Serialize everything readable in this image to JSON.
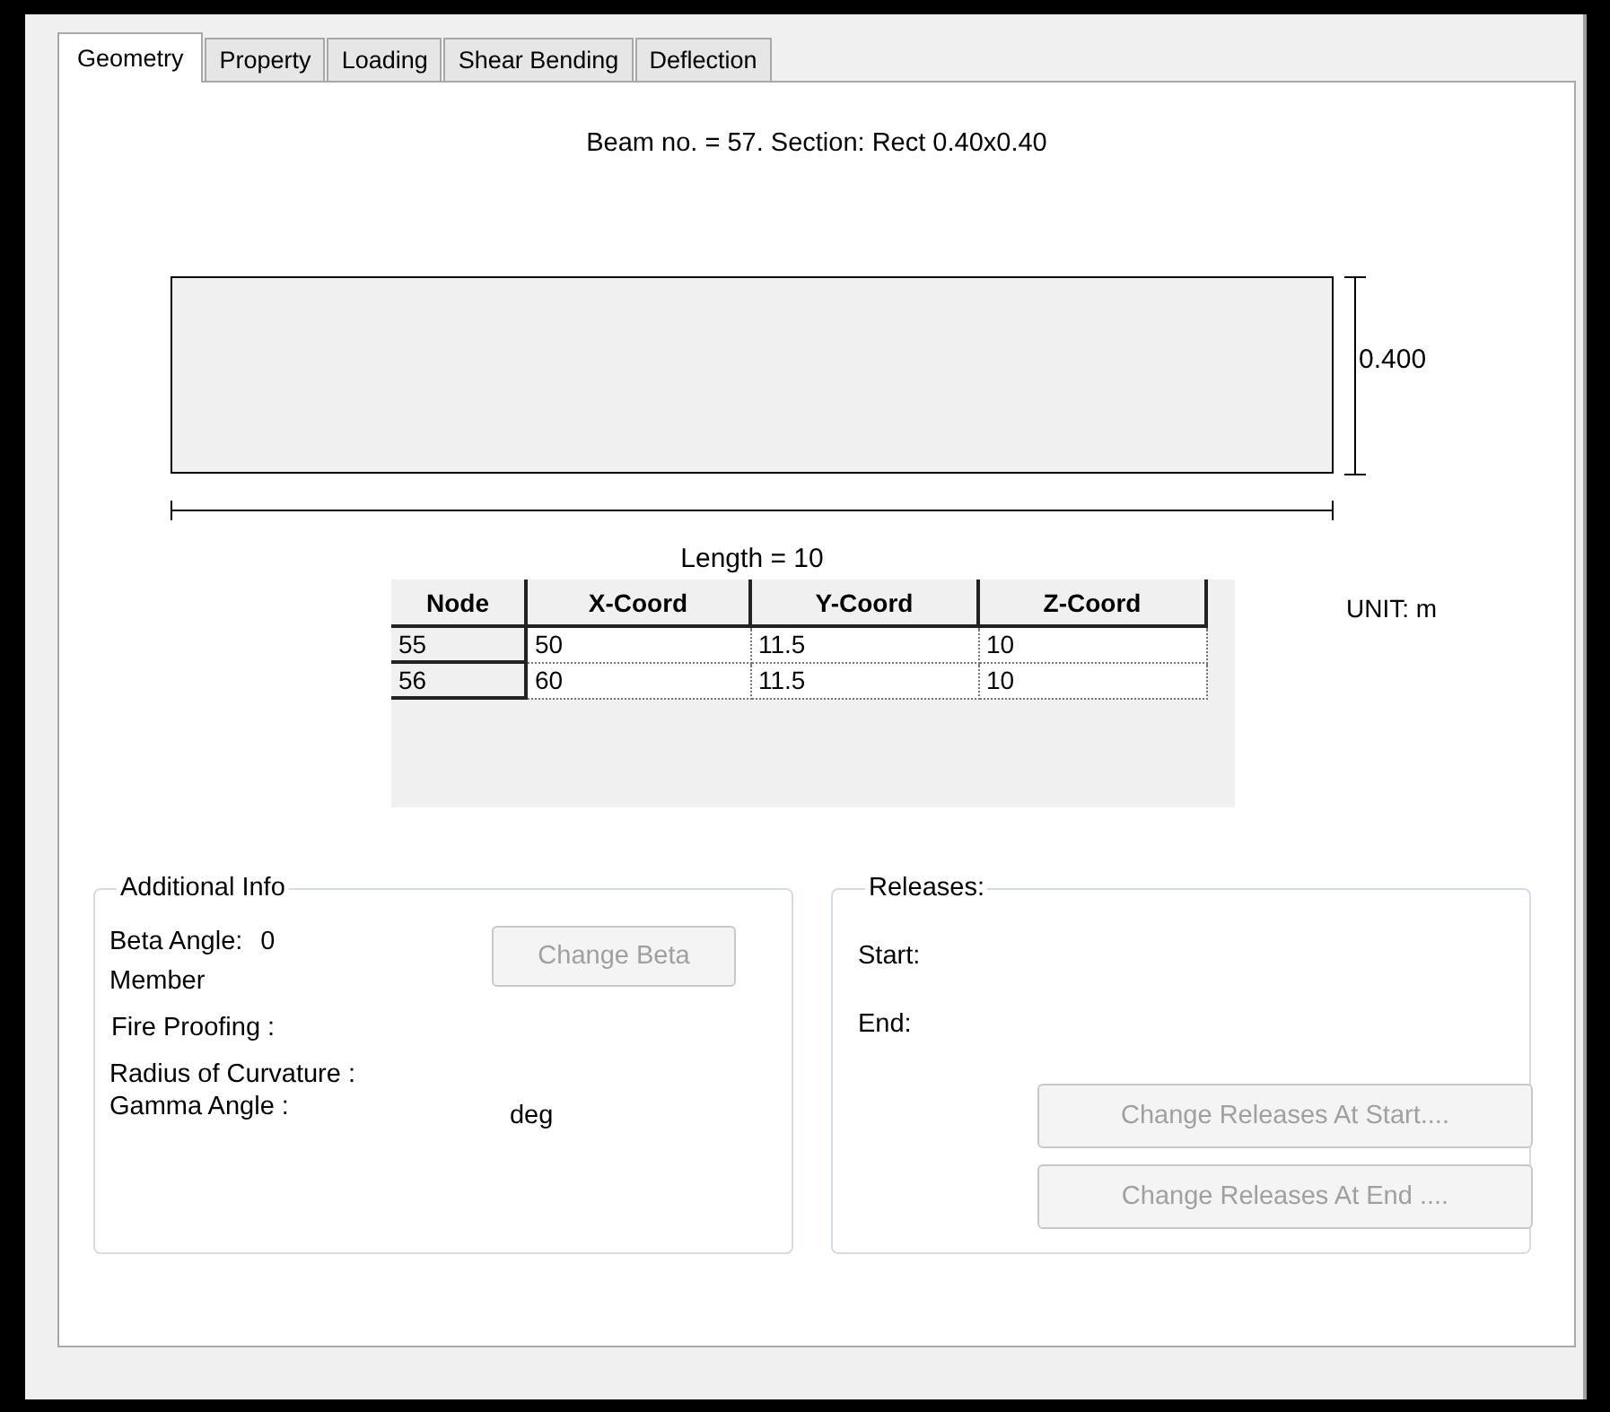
{
  "tabs": [
    {
      "label": "Geometry",
      "selected": true
    },
    {
      "label": "Property",
      "selected": false
    },
    {
      "label": "Loading",
      "selected": false
    },
    {
      "label": "Shear Bending",
      "selected": false
    },
    {
      "label": "Deflection",
      "selected": false
    }
  ],
  "caption": "Beam no. = 57. Section: Rect 0.40x0.40",
  "drawing": {
    "depth_label": "0.400",
    "length_label": "Length = 10"
  },
  "unit": "UNIT: m",
  "table": {
    "columns": [
      "Node",
      "X-Coord",
      "Y-Coord",
      "Z-Coord"
    ],
    "rows": [
      [
        "55",
        "50",
        "11.5",
        "10"
      ],
      [
        "56",
        "60",
        "11.5",
        "10"
      ]
    ]
  },
  "additional_info": {
    "title": "Additional Info",
    "beta_label": "Beta Angle:",
    "beta_value": "0",
    "member": "Member",
    "fire_proofing": "Fire Proofing :",
    "radius": "Radius of Curvature :",
    "gamma": "Gamma Angle :",
    "gamma_unit": "deg",
    "button": {
      "label": "Change Beta",
      "disabled": true
    }
  },
  "releases": {
    "title": "Releases:",
    "start": "Start:",
    "end": "End:",
    "buttons": [
      {
        "label": "Change Releases At Start....",
        "disabled": true
      },
      {
        "label": "Change Releases At End ....",
        "disabled": true
      }
    ]
  }
}
